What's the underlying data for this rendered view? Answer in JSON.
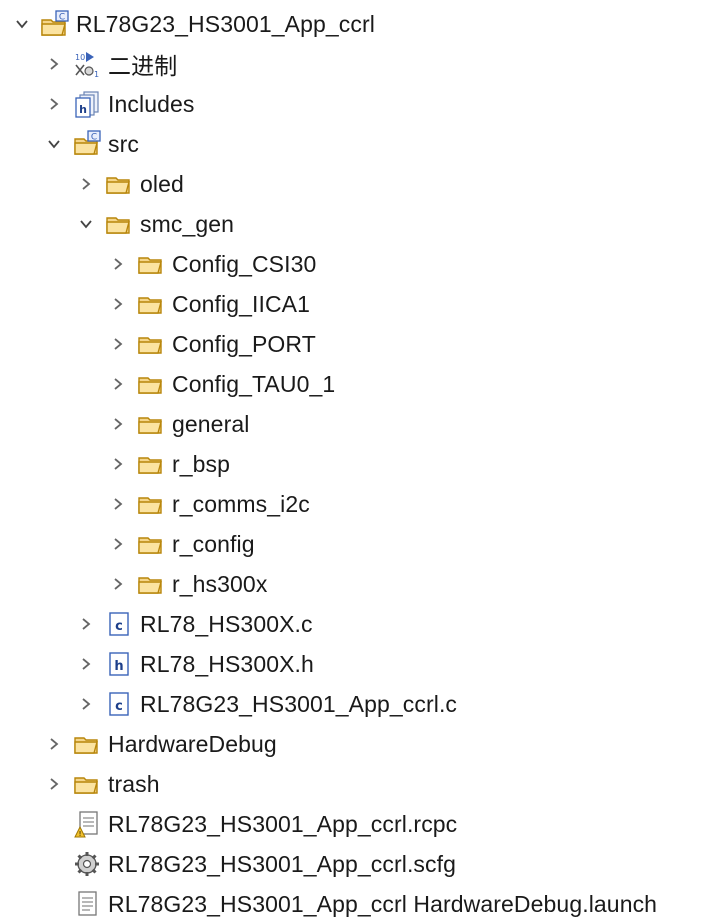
{
  "tree": [
    {
      "name": "project-rl78g23-hs3001-app-ccrl",
      "label": "RL78G23_HS3001_App_ccrl",
      "level": 0,
      "arrow": "expanded",
      "icon": "c-project-icon"
    },
    {
      "name": "binaries",
      "label": "二进制",
      "level": 1,
      "arrow": "collapsed",
      "icon": "binaries-icon"
    },
    {
      "name": "includes",
      "label": "Includes",
      "level": 1,
      "arrow": "collapsed",
      "icon": "includes-icon"
    },
    {
      "name": "src",
      "label": "src",
      "level": 1,
      "arrow": "expanded",
      "icon": "source-folder-icon"
    },
    {
      "name": "oled",
      "label": "oled",
      "level": 2,
      "arrow": "collapsed",
      "icon": "folder-icon"
    },
    {
      "name": "smc-gen",
      "label": "smc_gen",
      "level": 2,
      "arrow": "expanded",
      "icon": "folder-icon"
    },
    {
      "name": "config-csi30",
      "label": "Config_CSI30",
      "level": 3,
      "arrow": "collapsed",
      "icon": "folder-icon"
    },
    {
      "name": "config-iica1",
      "label": "Config_IICA1",
      "level": 3,
      "arrow": "collapsed",
      "icon": "folder-icon"
    },
    {
      "name": "config-port",
      "label": "Config_PORT",
      "level": 3,
      "arrow": "collapsed",
      "icon": "folder-icon"
    },
    {
      "name": "config-tau0-1",
      "label": "Config_TAU0_1",
      "level": 3,
      "arrow": "collapsed",
      "icon": "folder-icon"
    },
    {
      "name": "general",
      "label": "general",
      "level": 3,
      "arrow": "collapsed",
      "icon": "folder-icon"
    },
    {
      "name": "r-bsp",
      "label": "r_bsp",
      "level": 3,
      "arrow": "collapsed",
      "icon": "folder-icon"
    },
    {
      "name": "r-comms-i2c",
      "label": "r_comms_i2c",
      "level": 3,
      "arrow": "collapsed",
      "icon": "folder-icon"
    },
    {
      "name": "r-config",
      "label": "r_config",
      "level": 3,
      "arrow": "collapsed",
      "icon": "folder-icon"
    },
    {
      "name": "r-hs300x",
      "label": "r_hs300x",
      "level": 3,
      "arrow": "collapsed",
      "icon": "folder-icon"
    },
    {
      "name": "rl78-hs300x-c",
      "label": "RL78_HS300X.c",
      "level": 2,
      "arrow": "collapsed",
      "icon": "c-file-icon"
    },
    {
      "name": "rl78-hs300x-h",
      "label": "RL78_HS300X.h",
      "level": 2,
      "arrow": "collapsed",
      "icon": "h-file-icon"
    },
    {
      "name": "rl78g23-hs3001-app-ccrl-c",
      "label": "RL78G23_HS3001_App_ccrl.c",
      "level": 2,
      "arrow": "collapsed",
      "icon": "c-file-icon"
    },
    {
      "name": "hardware-debug",
      "label": "HardwareDebug",
      "level": 1,
      "arrow": "collapsed",
      "icon": "folder-icon"
    },
    {
      "name": "trash",
      "label": "trash",
      "level": 1,
      "arrow": "collapsed",
      "icon": "folder-icon"
    },
    {
      "name": "rcpc-file",
      "label": "RL78G23_HS3001_App_ccrl.rcpc",
      "level": 1,
      "arrow": "none",
      "icon": "rcpc-file-icon"
    },
    {
      "name": "scfg-file",
      "label": "RL78G23_HS3001_App_ccrl.scfg",
      "level": 1,
      "arrow": "none",
      "icon": "gear-file-icon"
    },
    {
      "name": "launch-file",
      "label": "RL78G23_HS3001_App_ccrl HardwareDebug.launch",
      "level": 1,
      "arrow": "none",
      "icon": "launch-file-icon"
    }
  ]
}
